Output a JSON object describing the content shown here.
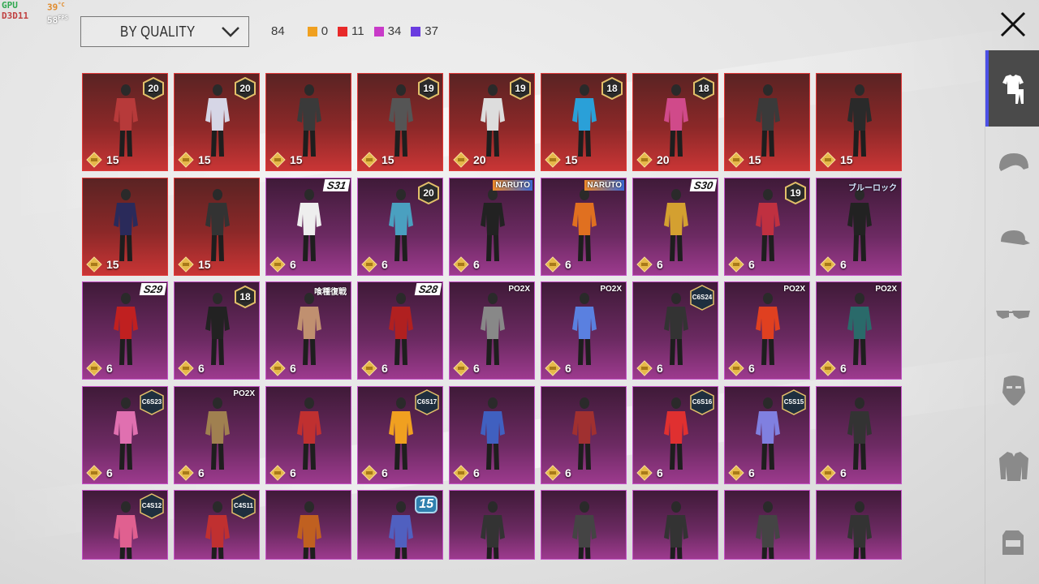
{
  "overlay": {
    "gpu": "GPU",
    "api": "D3D11",
    "temp": "39",
    "temp_unit": "°C",
    "fps": "58",
    "fps_unit": "FPS"
  },
  "sort": {
    "label": "BY QUALITY",
    "icon": "chevron-down-icon"
  },
  "counts": {
    "total": "84",
    "items": [
      {
        "color": "#f0a020",
        "value": "0"
      },
      {
        "color": "#e82a2a",
        "value": "11"
      },
      {
        "color": "#c83ac8",
        "value": "34"
      },
      {
        "color": "#6a3ce0",
        "value": "37"
      }
    ]
  },
  "close": {
    "icon": "close-icon"
  },
  "side_tabs": [
    {
      "icon": "outfit-icon",
      "active": true
    },
    {
      "icon": "helmet-icon",
      "active": false
    },
    {
      "icon": "cap-icon",
      "active": false
    },
    {
      "icon": "glasses-icon",
      "active": false
    },
    {
      "icon": "mask-icon",
      "active": false
    },
    {
      "icon": "jacket-icon",
      "active": false
    },
    {
      "icon": "backpack-icon",
      "active": false
    }
  ],
  "colors": {
    "red_border": "#e23a3a",
    "purple_border": "#c653c9",
    "active_tab": "#4c50e6"
  },
  "cards": [
    {
      "rarity": "red",
      "value": "15",
      "badge": {
        "type": "level",
        "text": "20"
      }
    },
    {
      "rarity": "red",
      "value": "15",
      "badge": {
        "type": "level",
        "text": "20"
      }
    },
    {
      "rarity": "red",
      "value": "15",
      "badge": null
    },
    {
      "rarity": "red",
      "value": "15",
      "badge": {
        "type": "level",
        "text": "19"
      }
    },
    {
      "rarity": "red",
      "value": "20",
      "badge": {
        "type": "level",
        "text": "19"
      }
    },
    {
      "rarity": "red",
      "value": "15",
      "badge": {
        "type": "level",
        "text": "18"
      }
    },
    {
      "rarity": "red",
      "value": "20",
      "badge": {
        "type": "level",
        "text": "18"
      }
    },
    {
      "rarity": "red",
      "value": "15",
      "badge": null
    },
    {
      "rarity": "red",
      "value": "15",
      "badge": null
    },
    {
      "rarity": "red",
      "value": "15",
      "badge": null
    },
    {
      "rarity": "red",
      "value": "15",
      "badge": null
    },
    {
      "rarity": "purple",
      "value": "6",
      "badge": {
        "type": "season",
        "text": "S31"
      }
    },
    {
      "rarity": "purple",
      "value": "6",
      "badge": {
        "type": "level",
        "text": "20"
      }
    },
    {
      "rarity": "purple",
      "value": "6",
      "badge": {
        "type": "tag",
        "text": "NARUTO",
        "style": "orange"
      }
    },
    {
      "rarity": "purple",
      "value": "6",
      "badge": {
        "type": "tag",
        "text": "NARUTO",
        "style": "orange"
      }
    },
    {
      "rarity": "purple",
      "value": "6",
      "badge": {
        "type": "season",
        "text": "S30"
      }
    },
    {
      "rarity": "purple",
      "value": "6",
      "badge": {
        "type": "level",
        "text": "19"
      }
    },
    {
      "rarity": "purple",
      "value": "6",
      "badge": {
        "type": "tag",
        "text": "ブルーロック",
        "style": "blue"
      }
    },
    {
      "rarity": "purple",
      "value": "6",
      "badge": {
        "type": "season",
        "text": "S29"
      }
    },
    {
      "rarity": "purple",
      "value": "6",
      "badge": {
        "type": "level",
        "text": "18"
      }
    },
    {
      "rarity": "purple",
      "value": "6",
      "badge": {
        "type": "tag",
        "text": "喰種復戦",
        "style": "plain"
      }
    },
    {
      "rarity": "purple",
      "value": "6",
      "badge": {
        "type": "season",
        "text": "S28"
      }
    },
    {
      "rarity": "purple",
      "value": "6",
      "badge": {
        "type": "tag",
        "text": "PO2X",
        "style": "plain"
      }
    },
    {
      "rarity": "purple",
      "value": "6",
      "badge": {
        "type": "tag",
        "text": "PO2X",
        "style": "plain"
      }
    },
    {
      "rarity": "purple",
      "value": "6",
      "badge": {
        "type": "cycle",
        "text": "C6S24"
      }
    },
    {
      "rarity": "purple",
      "value": "6",
      "badge": {
        "type": "tag",
        "text": "PO2X",
        "style": "plain"
      }
    },
    {
      "rarity": "purple",
      "value": "6",
      "badge": {
        "type": "tag",
        "text": "PO2X",
        "style": "plain"
      }
    },
    {
      "rarity": "purple",
      "value": "6",
      "badge": {
        "type": "cycle",
        "text": "C6S23"
      }
    },
    {
      "rarity": "purple",
      "value": "6",
      "badge": {
        "type": "tag",
        "text": "PO2X",
        "style": "plain"
      }
    },
    {
      "rarity": "purple",
      "value": "6",
      "badge": null
    },
    {
      "rarity": "purple",
      "value": "6",
      "badge": {
        "type": "cycle",
        "text": "C6S17"
      }
    },
    {
      "rarity": "purple",
      "value": "6",
      "badge": null
    },
    {
      "rarity": "purple",
      "value": "6",
      "badge": null
    },
    {
      "rarity": "purple",
      "value": "6",
      "badge": {
        "type": "cycle",
        "text": "C6S16"
      }
    },
    {
      "rarity": "purple",
      "value": "6",
      "badge": {
        "type": "cycle",
        "text": "C5S15"
      }
    },
    {
      "rarity": "purple",
      "value": "6",
      "badge": null
    },
    {
      "rarity": "purple",
      "value": "",
      "badge": {
        "type": "cycle",
        "text": "C4S12"
      }
    },
    {
      "rarity": "purple",
      "value": "",
      "badge": {
        "type": "cycle",
        "text": "C4S11"
      }
    },
    {
      "rarity": "purple",
      "value": "",
      "badge": null
    },
    {
      "rarity": "purple",
      "value": "",
      "badge": {
        "type": "fifteen",
        "text": "15"
      }
    },
    {
      "rarity": "purple",
      "value": "",
      "badge": null
    },
    {
      "rarity": "purple",
      "value": "",
      "badge": null
    },
    {
      "rarity": "purple",
      "value": "",
      "badge": null
    },
    {
      "rarity": "purple",
      "value": "",
      "badge": null
    },
    {
      "rarity": "purple",
      "value": "",
      "badge": null
    }
  ]
}
